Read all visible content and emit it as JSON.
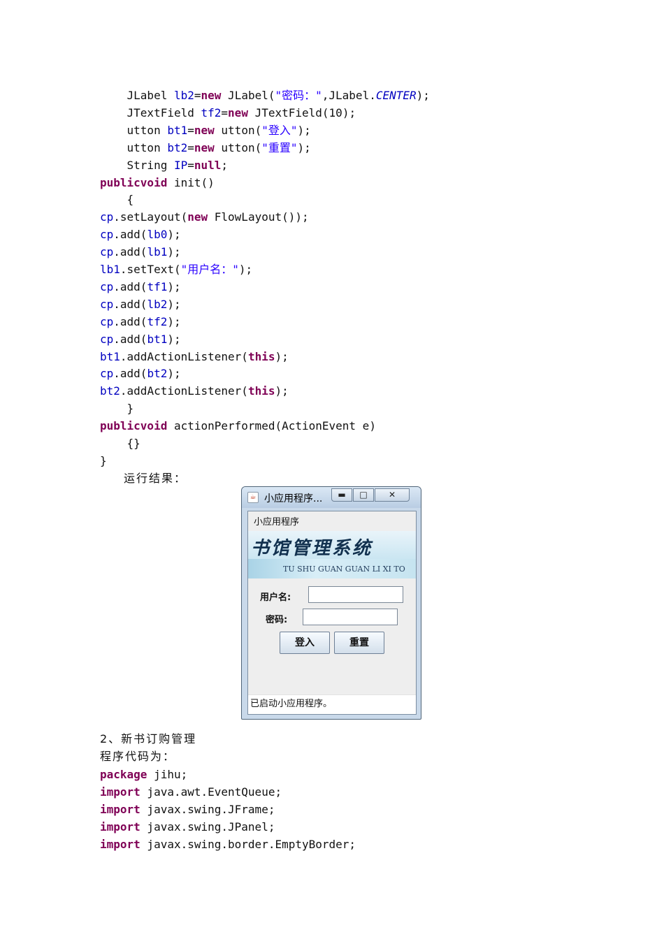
{
  "code_before": [
    {
      "i": 0,
      "segs": [
        [
          "p",
          "    JLabel "
        ],
        [
          "f",
          "lb2"
        ],
        [
          "p",
          "="
        ],
        [
          "k",
          "new"
        ],
        [
          "p",
          " JLabel("
        ],
        [
          "s",
          "\"密码：\""
        ],
        [
          "p",
          ",JLabel."
        ],
        [
          "i",
          "CENTER"
        ],
        [
          "p",
          ");"
        ]
      ]
    },
    {
      "i": 1,
      "segs": [
        [
          "p",
          "    JTextField "
        ],
        [
          "f",
          "tf2"
        ],
        [
          "p",
          "="
        ],
        [
          "k",
          "new"
        ],
        [
          "p",
          " JTextField(10);"
        ]
      ]
    },
    {
      "i": 2,
      "segs": [
        [
          "p",
          "    utton "
        ],
        [
          "f",
          "bt1"
        ],
        [
          "p",
          "="
        ],
        [
          "k",
          "new"
        ],
        [
          "p",
          " utton("
        ],
        [
          "s",
          "\"登入\""
        ],
        [
          "p",
          ");"
        ]
      ]
    },
    {
      "i": 3,
      "segs": [
        [
          "p",
          "    utton "
        ],
        [
          "f",
          "bt2"
        ],
        [
          "p",
          "="
        ],
        [
          "k",
          "new"
        ],
        [
          "p",
          " utton("
        ],
        [
          "s",
          "\"重置\""
        ],
        [
          "p",
          ");"
        ]
      ]
    },
    {
      "i": 4,
      "segs": [
        [
          "p",
          "    String "
        ],
        [
          "f",
          "IP"
        ],
        [
          "p",
          "="
        ],
        [
          "k",
          "null"
        ],
        [
          "p",
          ";"
        ]
      ]
    },
    {
      "i": 5,
      "segs": [
        [
          "k",
          "publicvoid"
        ],
        [
          "p",
          " init()"
        ]
      ]
    },
    {
      "i": 6,
      "segs": [
        [
          "p",
          "    {"
        ]
      ]
    },
    {
      "i": 7,
      "segs": [
        [
          "f",
          "cp"
        ],
        [
          "p",
          ".setLayout("
        ],
        [
          "k",
          "new"
        ],
        [
          "p",
          " FlowLayout());"
        ]
      ]
    },
    {
      "i": 8,
      "segs": [
        [
          "f",
          "cp"
        ],
        [
          "p",
          ".add("
        ],
        [
          "f",
          "lb0"
        ],
        [
          "p",
          ");"
        ]
      ]
    },
    {
      "i": 9,
      "segs": [
        [
          "f",
          "cp"
        ],
        [
          "p",
          ".add("
        ],
        [
          "f",
          "lb1"
        ],
        [
          "p",
          ");"
        ]
      ]
    },
    {
      "i": 10,
      "segs": [
        [
          "f",
          "lb1"
        ],
        [
          "p",
          ".setText("
        ],
        [
          "s",
          "\"用户名：\""
        ],
        [
          "p",
          ");"
        ]
      ]
    },
    {
      "i": 11,
      "segs": [
        [
          "f",
          "cp"
        ],
        [
          "p",
          ".add("
        ],
        [
          "f",
          "tf1"
        ],
        [
          "p",
          ");"
        ]
      ]
    },
    {
      "i": 12,
      "segs": [
        [
          "f",
          "cp"
        ],
        [
          "p",
          ".add("
        ],
        [
          "f",
          "lb2"
        ],
        [
          "p",
          ");"
        ]
      ]
    },
    {
      "i": 13,
      "segs": [
        [
          "f",
          "cp"
        ],
        [
          "p",
          ".add("
        ],
        [
          "f",
          "tf2"
        ],
        [
          "p",
          ");"
        ]
      ]
    },
    {
      "i": 14,
      "segs": [
        [
          "f",
          "cp"
        ],
        [
          "p",
          ".add("
        ],
        [
          "f",
          "bt1"
        ],
        [
          "p",
          ");"
        ]
      ]
    },
    {
      "i": 15,
      "segs": [
        [
          "f",
          "bt1"
        ],
        [
          "p",
          ".addActionListener("
        ],
        [
          "k",
          "this"
        ],
        [
          "p",
          ");"
        ]
      ]
    },
    {
      "i": 16,
      "segs": [
        [
          "f",
          "cp"
        ],
        [
          "p",
          ".add("
        ],
        [
          "f",
          "bt2"
        ],
        [
          "p",
          ");"
        ]
      ]
    },
    {
      "i": 17,
      "segs": [
        [
          "f",
          "bt2"
        ],
        [
          "p",
          ".addActionListener("
        ],
        [
          "k",
          "this"
        ],
        [
          "p",
          ");"
        ]
      ]
    },
    {
      "i": 18,
      "segs": [
        [
          "p",
          "    }"
        ]
      ]
    },
    {
      "i": 19,
      "segs": [
        [
          "k",
          "publicvoid"
        ],
        [
          "p",
          " actionPerformed(ActionEvent e)"
        ]
      ]
    },
    {
      "i": 20,
      "segs": [
        [
          "p",
          "    {}"
        ]
      ]
    },
    {
      "i": 21,
      "segs": [
        [
          "p",
          "}"
        ]
      ]
    }
  ],
  "run_result_label": "运行结果：",
  "applet": {
    "window_title": "小应用程序...",
    "minimize_glyph": "▬",
    "maximize_glyph": "□",
    "close_glyph": "✕",
    "menu_label": "小应用程序",
    "banner_title": "书馆管理系统",
    "banner_subtitle": "TU SHU GUAN GUAN LI XI TO",
    "username_label": "用户名:",
    "password_label": "密码:",
    "username_value": "",
    "password_value": "",
    "login_button": "登入",
    "reset_button": "重置",
    "status": "已启动小应用程序。"
  },
  "section_heading": "2、新书订购管理",
  "code_intro": "程序代码为：",
  "code_after": [
    {
      "i": 0,
      "segs": [
        [
          "k",
          "package"
        ],
        [
          "p",
          " jihu;"
        ]
      ]
    },
    {
      "i": 1,
      "segs": [
        [
          "k",
          "import"
        ],
        [
          "p",
          " java.awt.EventQueue;"
        ]
      ]
    },
    {
      "i": 2,
      "segs": [
        [
          "k",
          "import"
        ],
        [
          "p",
          " javax.swing.JFrame;"
        ]
      ]
    },
    {
      "i": 3,
      "segs": [
        [
          "k",
          "import"
        ],
        [
          "p",
          " javax.swing.JPanel;"
        ]
      ]
    },
    {
      "i": 4,
      "segs": [
        [
          "k",
          "import"
        ],
        [
          "p",
          " javax.swing.border.EmptyBorder;"
        ]
      ]
    }
  ]
}
